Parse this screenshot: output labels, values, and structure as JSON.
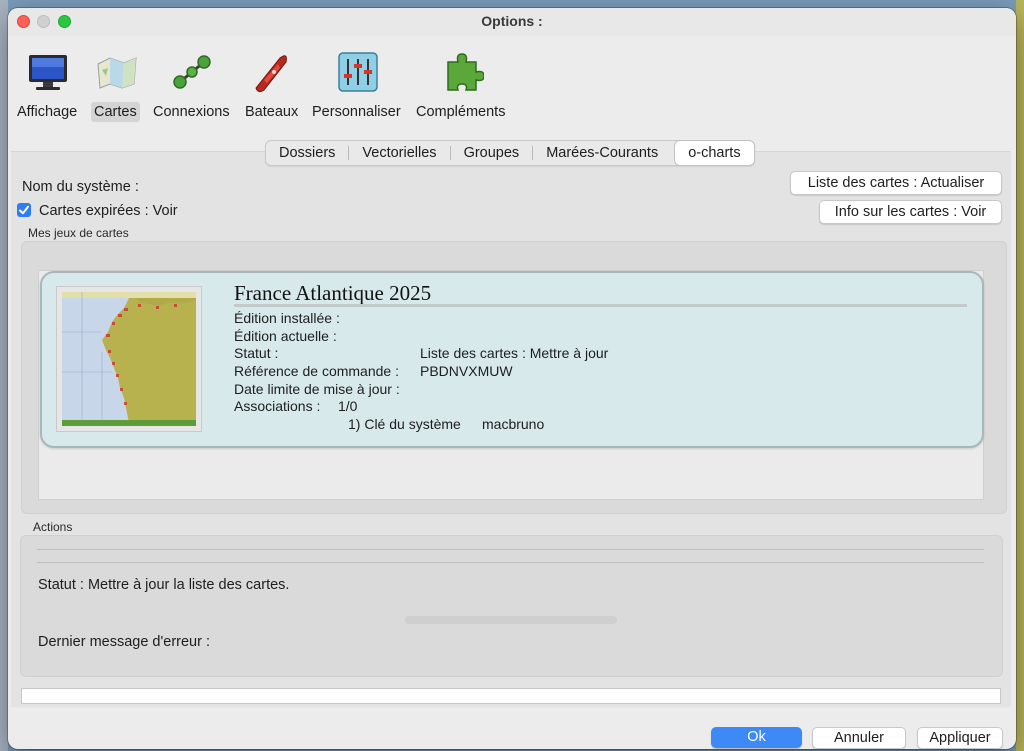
{
  "window": {
    "title": "Options :"
  },
  "toolbar": {
    "items": [
      {
        "label": "Affichage",
        "icon": "monitor-icon"
      },
      {
        "label": "Cartes",
        "icon": "chart-map-icon",
        "selected": true
      },
      {
        "label": "Connexions",
        "icon": "connections-icon"
      },
      {
        "label": "Bateaux",
        "icon": "boat-icon"
      },
      {
        "label": "Personnaliser",
        "icon": "sliders-icon"
      },
      {
        "label": "Compléments",
        "icon": "puzzle-icon"
      }
    ]
  },
  "tabs": [
    {
      "label": "Dossiers"
    },
    {
      "label": "Vectorielles"
    },
    {
      "label": "Groupes"
    },
    {
      "label": "Marées-Courants"
    },
    {
      "label": "o-charts",
      "active": true
    }
  ],
  "system": {
    "name_label": "Nom du système :",
    "expired_label": "Cartes expirées : Voir",
    "expired_checked": true,
    "list_button": "Liste des cartes : Actualiser",
    "info_button": "Info sur les cartes : Voir"
  },
  "chartsets": {
    "group_title": "Mes jeux de cartes",
    "card": {
      "title": "France Atlantique 2025",
      "installed": "Édition installée :",
      "current": "Édition actuelle :",
      "status_label": "Statut :",
      "status_value": "Liste des cartes : Mettre à jour",
      "order_label": "Référence de commande :",
      "order_value": "PBDNVXMUW",
      "deadline_label": "Date limite de mise à jour :",
      "assoc_label": "Associations :",
      "assoc_value": "1/0",
      "key_label": "1) Clé du système",
      "key_value": "macbruno"
    }
  },
  "actions": {
    "group_title": "Actions",
    "status_text": "Statut : Mettre à jour la liste des cartes.",
    "last_error_label": "Dernier message d'erreur :"
  },
  "footer": {
    "ok": "Ok",
    "cancel": "Annuler",
    "apply": "Appliquer"
  },
  "colors": {
    "accent": "#3d8af7",
    "card_bg": "#d8e9ec",
    "close": "#fe5f57",
    "maximize": "#2ac840"
  }
}
